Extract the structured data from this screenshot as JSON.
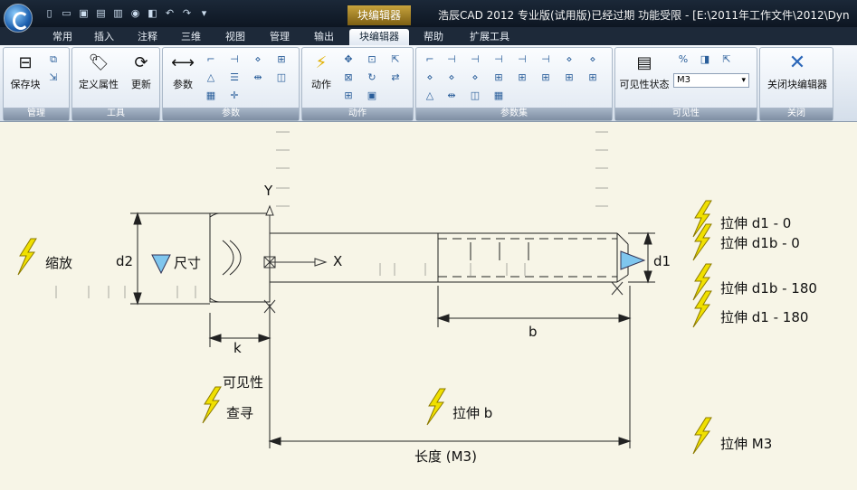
{
  "titlebar": {
    "context_tab": "块编辑器",
    "title": "浩辰CAD 2012 专业版(试用版)已经过期 功能受限 - [E:\\2011年工作文件\\2012\\Dyn"
  },
  "tabs": [
    {
      "label": "常用"
    },
    {
      "label": "插入"
    },
    {
      "label": "注释"
    },
    {
      "label": "三维"
    },
    {
      "label": "视图"
    },
    {
      "label": "管理"
    },
    {
      "label": "输出"
    },
    {
      "label": "块编辑器"
    },
    {
      "label": "帮助"
    },
    {
      "label": "扩展工具"
    }
  ],
  "ribbon": {
    "manage": {
      "label": "管理",
      "save_block": "保存块"
    },
    "tools": {
      "label": "工具",
      "define_attr": "定义属性",
      "update": "更新"
    },
    "params": {
      "label": "参数",
      "param": "参数"
    },
    "actions": {
      "label": "动作",
      "action": "动作"
    },
    "paramsets": {
      "label": "参数集"
    },
    "visibility": {
      "label": "可见性",
      "vis_state": "可见性状态",
      "combo_value": "M3"
    },
    "close": {
      "label": "关闭",
      "close_editor": "关闭块编辑器"
    }
  },
  "drawing": {
    "y_axis": "Y",
    "x_axis": "X",
    "d2": "d2",
    "dim_size": "尺寸",
    "scale": "缩放",
    "k": "k",
    "b": "b",
    "length": "长度 (M3)",
    "d1": "d1",
    "visibility": "可见性",
    "lookup": "查寻",
    "stretch_b": "拉伸 b",
    "stretch_d1_0": "拉伸 d1 - 0",
    "stretch_d1b_0": "拉伸 d1b - 0",
    "stretch_d1b_180": "拉伸 d1b - 180",
    "stretch_d1_180": "拉伸 d1 - 180",
    "stretch_m3": "拉伸 M3"
  },
  "colors": {
    "canvas": "#f7f5e7",
    "accent": "#f0e000",
    "marker": "#7fc6ee"
  }
}
